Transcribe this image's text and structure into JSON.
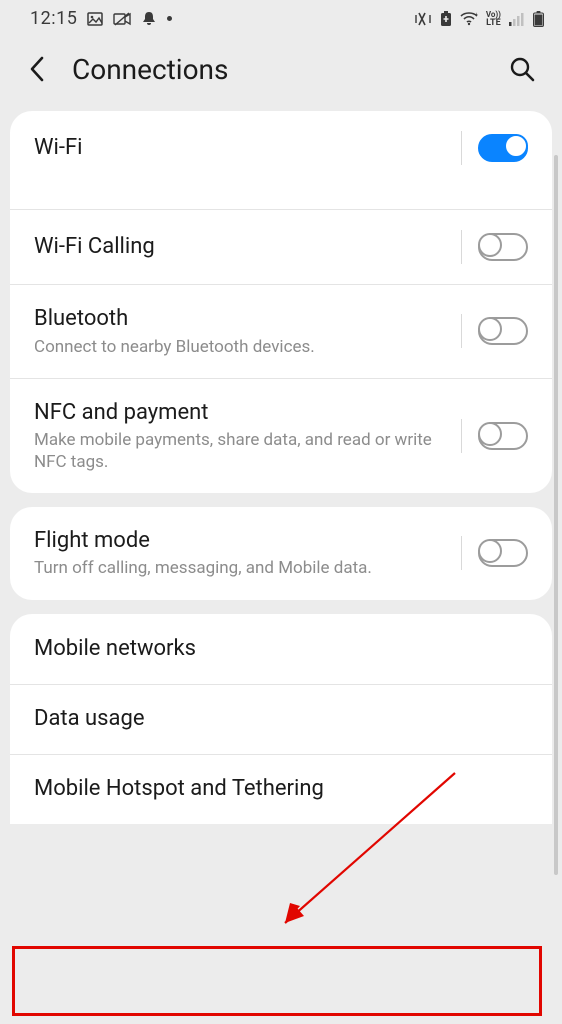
{
  "status": {
    "time": "12:15"
  },
  "header": {
    "title": "Connections"
  },
  "groups": [
    {
      "rows": [
        {
          "title": "Wi-Fi",
          "sub": "",
          "toggle": true,
          "on": true
        },
        {
          "title": "Wi-Fi Calling",
          "sub": "",
          "toggle": true,
          "on": false
        },
        {
          "title": "Bluetooth",
          "sub": "Connect to nearby Bluetooth devices.",
          "toggle": true,
          "on": false
        },
        {
          "title": "NFC and payment",
          "sub": "Make mobile payments, share data, and read or write NFC tags.",
          "toggle": true,
          "on": false
        }
      ]
    },
    {
      "rows": [
        {
          "title": "Flight mode",
          "sub": "Turn off calling, messaging, and Mobile data.",
          "toggle": true,
          "on": false
        }
      ]
    },
    {
      "rows": [
        {
          "title": "Mobile networks",
          "sub": "",
          "toggle": false
        },
        {
          "title": "Data usage",
          "sub": "",
          "toggle": false
        },
        {
          "title": "Mobile Hotspot and Tethering",
          "sub": "",
          "toggle": false
        }
      ]
    }
  ]
}
